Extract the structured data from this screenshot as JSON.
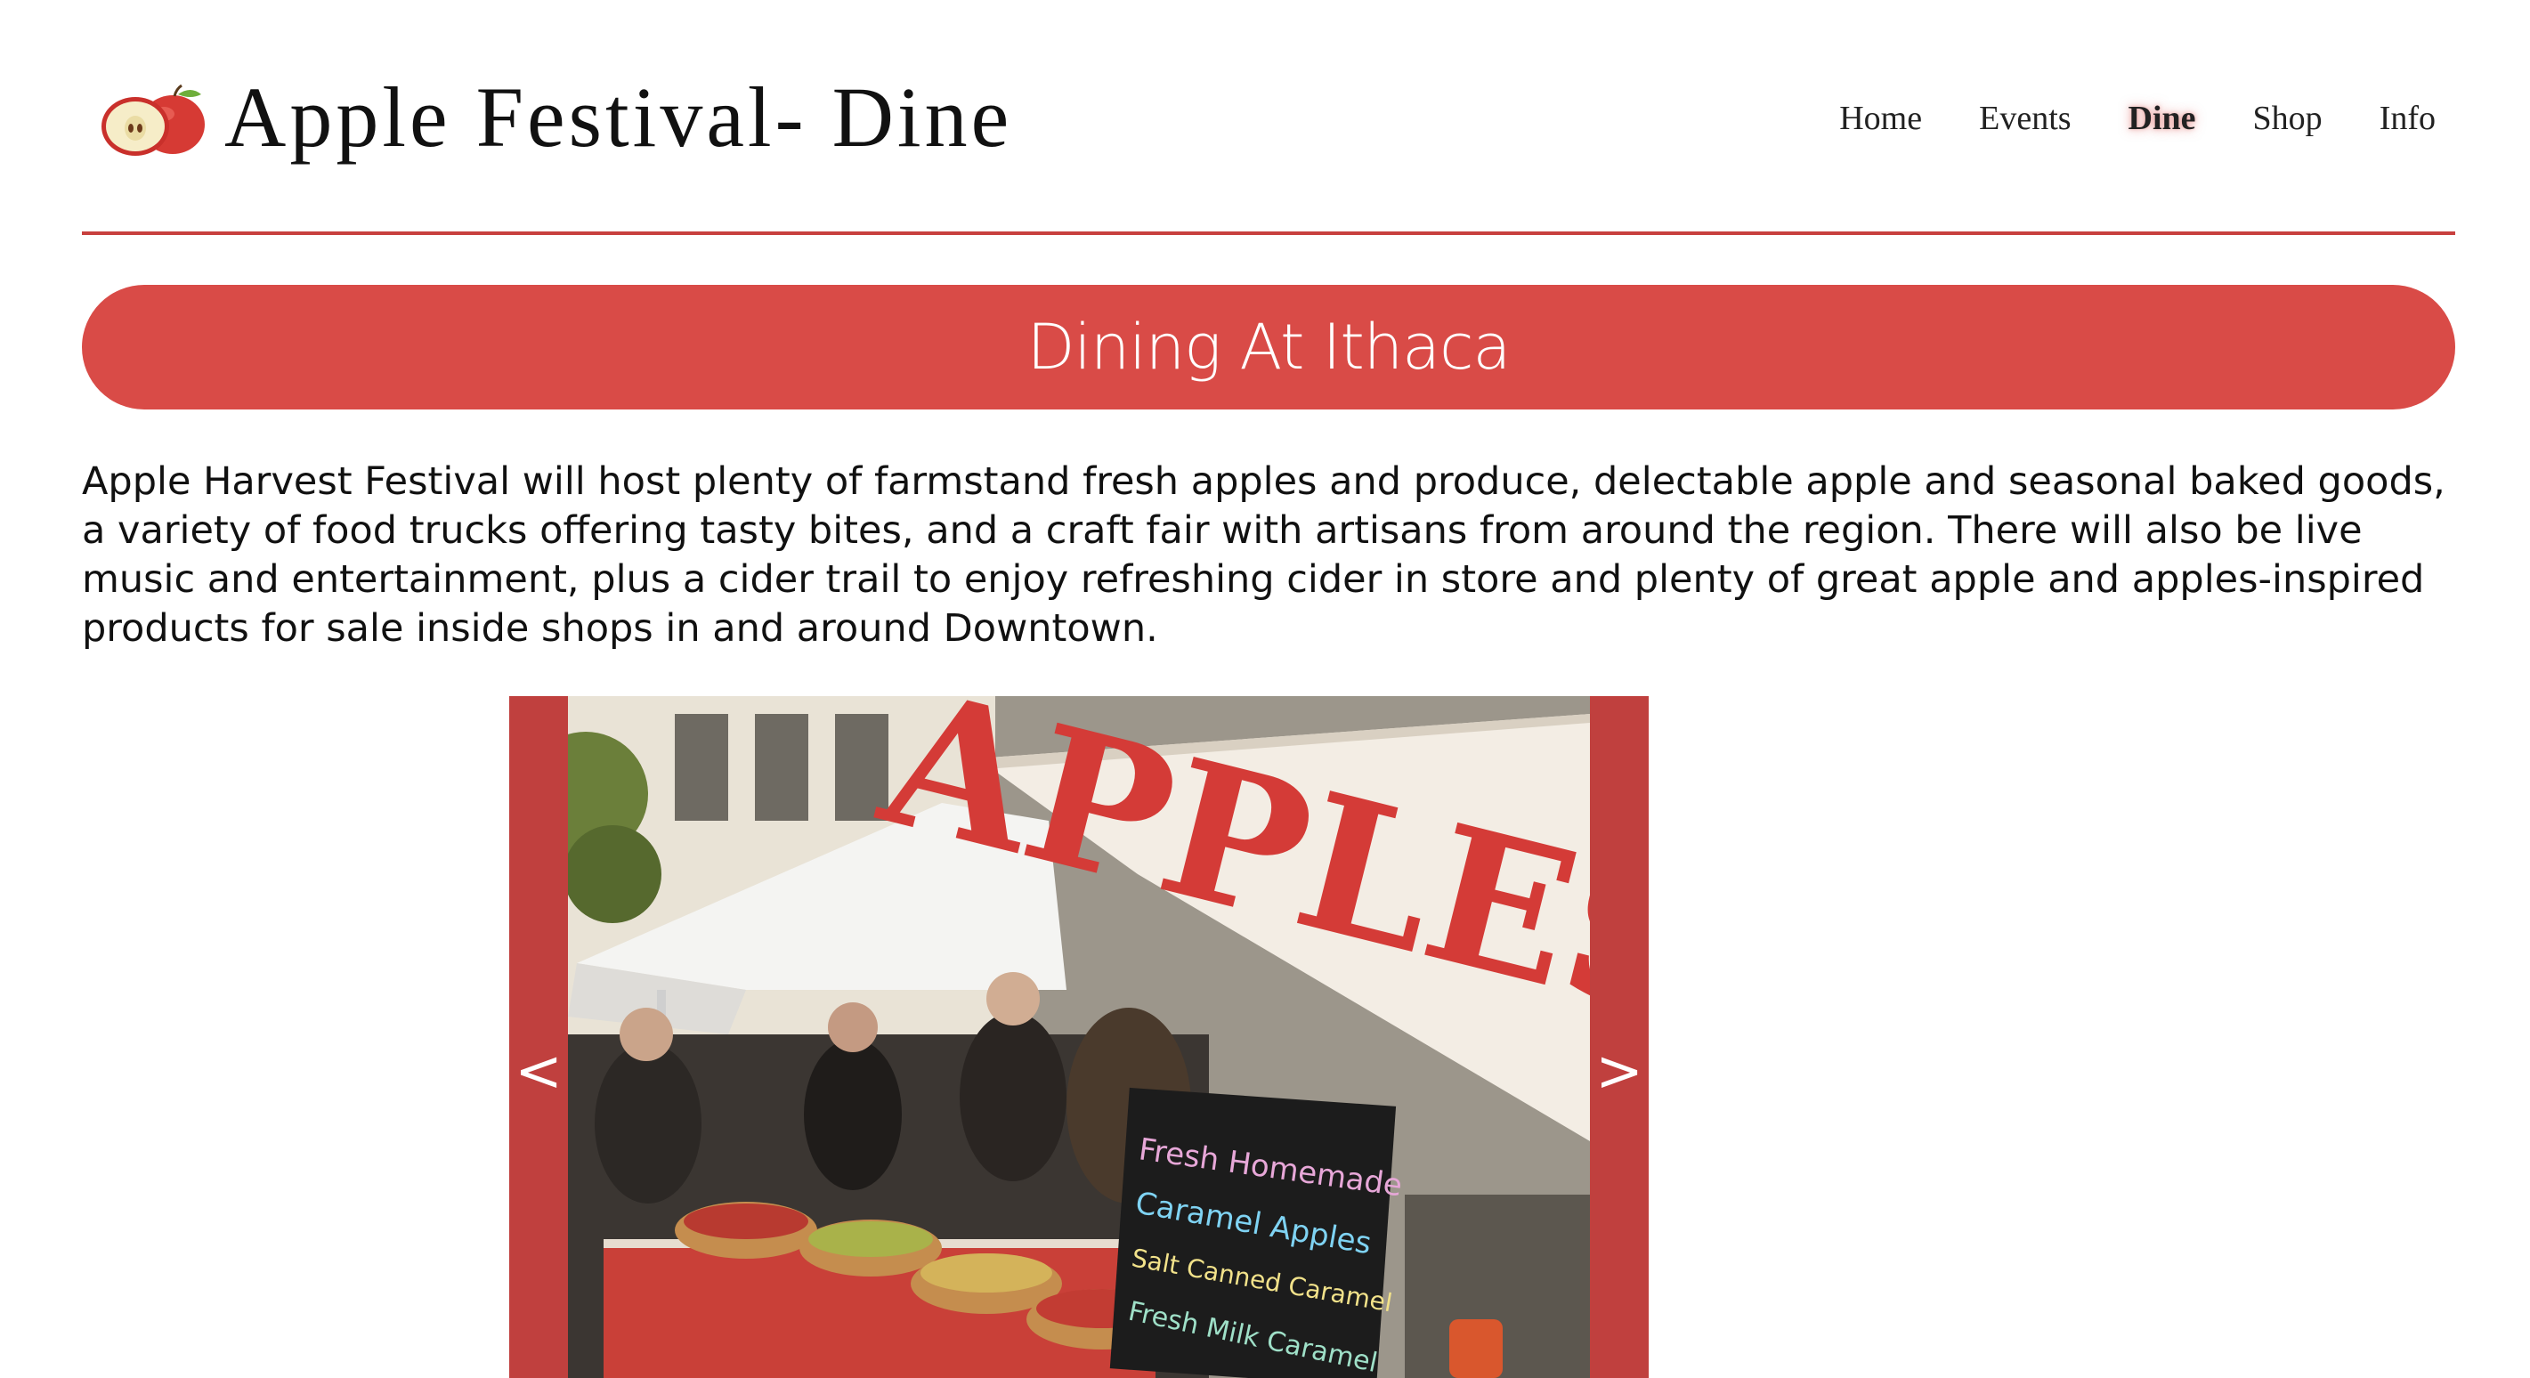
{
  "header": {
    "title": "Apple Festival- Dine",
    "logo_icon": "apple-icon"
  },
  "nav": {
    "items": [
      {
        "label": "Home",
        "active": false
      },
      {
        "label": "Events",
        "active": false
      },
      {
        "label": "Dine",
        "active": true
      },
      {
        "label": "Shop",
        "active": false
      },
      {
        "label": "Info",
        "active": false
      }
    ]
  },
  "banner": {
    "title": "Dining At Ithaca"
  },
  "intro": {
    "text": "Apple Harvest Festival will host plenty of farmstand fresh apples and produce, delectable apple and seasonal baked goods, a variety of food trucks offering tasty bites, and a craft fair with artisans from around the region. There will also be live music and entertainment, plus a cider trail to enjoy refreshing cider in store and plenty of great apple and apples-inspired products for sale inside shops in and around Downtown."
  },
  "slideshow": {
    "prev_label": "<",
    "next_label": ">",
    "sign_text": "APPLES",
    "chalkboard_lines": [
      "Fresh Homemade",
      "Caramel Apples",
      "Salt Canned Caramel",
      "Fresh Milk Caramel"
    ]
  },
  "colors": {
    "accent": "#d94b47",
    "divider": "#c8403e",
    "slideshow_frame": "#c0403e"
  }
}
